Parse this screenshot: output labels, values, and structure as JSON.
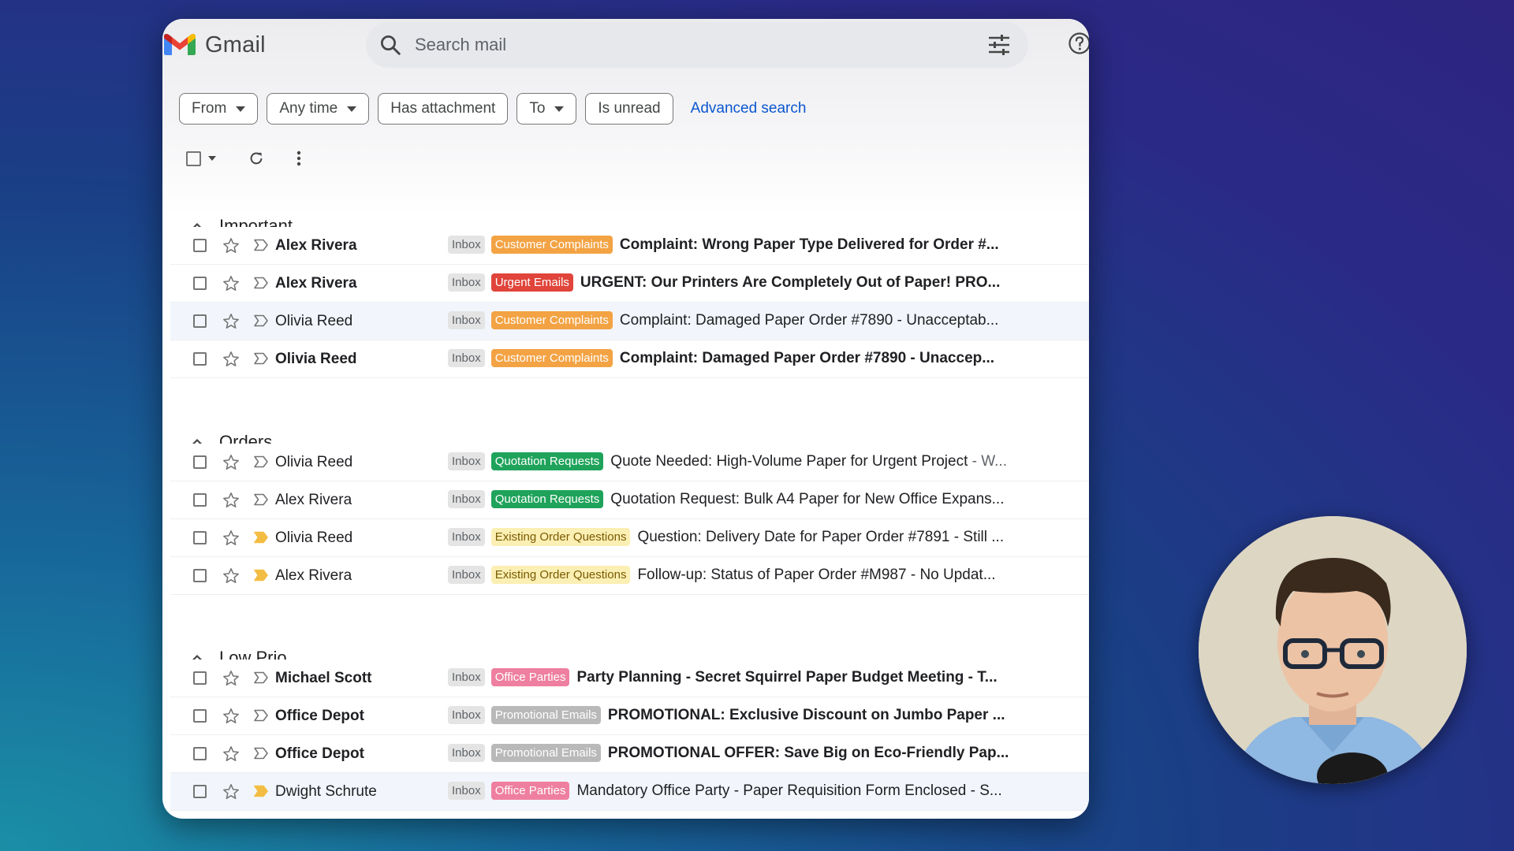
{
  "app": {
    "name": "Gmail"
  },
  "search": {
    "placeholder": "Search mail"
  },
  "filters": {
    "from": "From",
    "any_time": "Any time",
    "has_attachment": "Has attachment",
    "to": "To",
    "is_unread": "Is unread",
    "advanced": "Advanced search"
  },
  "colors": {
    "customer_complaints": "#f3a344",
    "urgent_emails": "#e0443a",
    "quotation_requests": "#1fa35b",
    "existing_order_questions": "#fcefb4",
    "promotional_emails": "#b9b9b9",
    "office_parties": "#ee7fa0",
    "important_marker": "#f2bd42"
  },
  "sections": [
    {
      "title": "Important",
      "rows": [
        {
          "sender": "Alex Rivera",
          "unread": true,
          "important": false,
          "inbox": "Inbox",
          "label": "Customer Complaints",
          "label_key": "customer_complaints",
          "subject": "Complaint: Wrong Paper Type Delivered for Order #...",
          "snippet": ""
        },
        {
          "sender": "Alex Rivera",
          "unread": true,
          "important": false,
          "inbox": "Inbox",
          "label": "Urgent Emails",
          "label_key": "urgent_emails",
          "subject": "URGENT: Our Printers Are Completely Out of Paper! PRO...",
          "snippet": ""
        },
        {
          "sender": "Olivia Reed",
          "unread": false,
          "important": false,
          "inbox": "Inbox",
          "label": "Customer Complaints",
          "label_key": "customer_complaints",
          "subject": "Complaint: Damaged Paper Order #7890 - Unacceptab...",
          "snippet": ""
        },
        {
          "sender": "Olivia Reed",
          "unread": true,
          "important": false,
          "inbox": "Inbox",
          "label": "Customer Complaints",
          "label_key": "customer_complaints",
          "subject": "Complaint: Damaged Paper Order #7890 - Unaccep...",
          "snippet": ""
        }
      ]
    },
    {
      "title": "Orders",
      "rows": [
        {
          "sender": "Olivia Reed",
          "unread": false,
          "important": false,
          "inbox": "Inbox",
          "label": "Quotation Requests",
          "label_key": "quotation_requests",
          "subject": "Quote Needed: High-Volume Paper for Urgent Project",
          "snippet": " - W..."
        },
        {
          "sender": "Alex Rivera",
          "unread": false,
          "important": false,
          "inbox": "Inbox",
          "label": "Quotation Requests",
          "label_key": "quotation_requests",
          "subject": "Quotation Request: Bulk A4 Paper for New Office Expans...",
          "snippet": ""
        },
        {
          "sender": "Olivia Reed",
          "unread": false,
          "important": true,
          "inbox": "Inbox",
          "label": "Existing Order Questions",
          "label_key": "existing_order_questions",
          "subject": "Question: Delivery Date for Paper Order #7891 - Still ...",
          "snippet": ""
        },
        {
          "sender": "Alex Rivera",
          "unread": false,
          "important": true,
          "inbox": "Inbox",
          "label": "Existing Order Questions",
          "label_key": "existing_order_questions",
          "subject": "Follow-up: Status of Paper Order #M987 - No Updat...",
          "snippet": ""
        }
      ]
    },
    {
      "title": "Low Prio",
      "rows": [
        {
          "sender": "Michael Scott",
          "unread": true,
          "important": false,
          "inbox": "Inbox",
          "label": "Office Parties",
          "label_key": "office_parties",
          "subject": "Party Planning - Secret Squirrel Paper Budget Meeting - T...",
          "snippet": ""
        },
        {
          "sender": "Office Depot",
          "unread": true,
          "important": false,
          "inbox": "Inbox",
          "label": "Promotional Emails",
          "label_key": "promotional_emails",
          "subject": "PROMOTIONAL: Exclusive Discount on Jumbo Paper ...",
          "snippet": ""
        },
        {
          "sender": "Office Depot",
          "unread": true,
          "important": false,
          "inbox": "Inbox",
          "label": "Promotional Emails",
          "label_key": "promotional_emails",
          "subject": "PROMOTIONAL OFFER: Save Big on Eco-Friendly Pap...",
          "snippet": ""
        },
        {
          "sender": "Dwight Schrute",
          "unread": false,
          "important": true,
          "inbox": "Inbox",
          "label": "Office Parties",
          "label_key": "office_parties",
          "subject": "Mandatory Office Party - Paper Requisition Form Enclosed - S...",
          "snippet": ""
        }
      ]
    }
  ],
  "icons": [
    "gmail-logo-icon",
    "search-icon",
    "tune-icon",
    "help-icon",
    "caret-down-icon",
    "checkbox-icon",
    "refresh-icon",
    "more-vert-icon",
    "chevron-up-icon",
    "star-icon",
    "importance-marker-icon"
  ]
}
